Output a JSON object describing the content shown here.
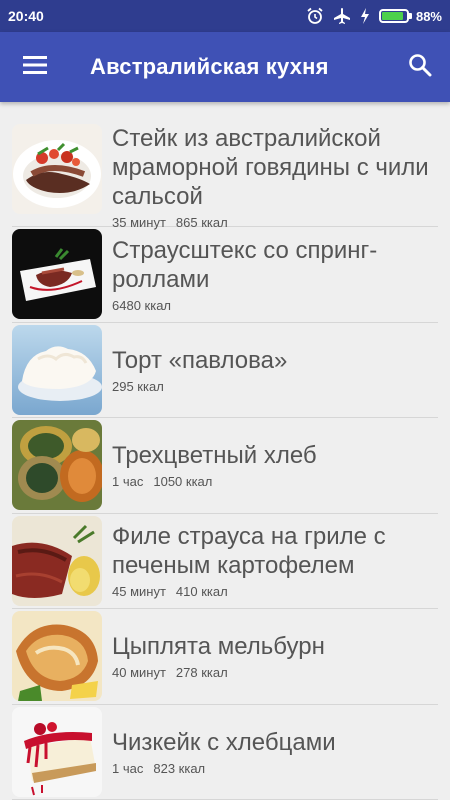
{
  "status_bar": {
    "time": "20:40",
    "battery_pct": "88%",
    "battery_level": 0.88,
    "icons": [
      "alarm-icon",
      "airplane-mode-icon",
      "charging-icon",
      "battery-icon"
    ]
  },
  "toolbar": {
    "title": "Австралийская кухня",
    "menu_icon": "hamburger-menu-icon",
    "search_icon": "search-icon"
  },
  "colors": {
    "status_bar": "#2f3d8f",
    "toolbar": "#3f51b5",
    "background": "#efefef",
    "text": "#555555"
  },
  "recipes": [
    {
      "title": "Стейк из австралийской мраморной говядины с чили сальсой",
      "time": "35 минут",
      "kcal": "865 ккал"
    },
    {
      "title": "Страусштекс со спринг-роллами",
      "time": "",
      "kcal": "6480 ккал"
    },
    {
      "title": "Торт «павлова»",
      "time": "",
      "kcal": "295 ккал"
    },
    {
      "title": "Трехцветный хлеб",
      "time": "1 час",
      "kcal": "1050 ккал"
    },
    {
      "title": "Филе страуса на гриле с печеным картофелем",
      "time": "45 минут",
      "kcal": "410 ккал"
    },
    {
      "title": "Цыплята мельбурн",
      "time": "40 минут",
      "kcal": "278 ккал"
    },
    {
      "title": "Чизкейк с хлебцами",
      "time": "1 час",
      "kcal": "823 ккал"
    }
  ]
}
